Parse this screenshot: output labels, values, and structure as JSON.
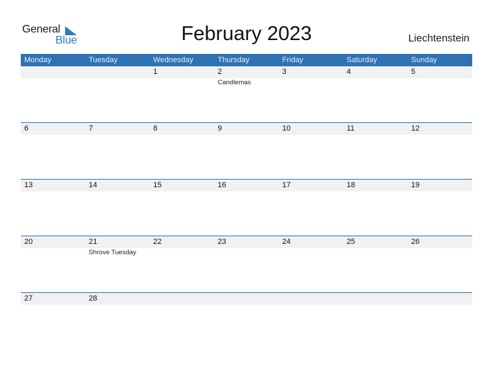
{
  "logo": {
    "general": "General",
    "blue": "Blue"
  },
  "title": "February 2023",
  "country": "Liechtenstein",
  "colors": {
    "accent": "#2e72b4",
    "date_strip": "#f1f1f1",
    "logo_blue": "#2e7bc4"
  },
  "weekdays": [
    "Monday",
    "Tuesday",
    "Wednesday",
    "Thursday",
    "Friday",
    "Saturday",
    "Sunday"
  ],
  "weeks": [
    {
      "days": [
        "",
        "",
        "1",
        "2",
        "3",
        "4",
        "5"
      ],
      "events": [
        "",
        "",
        "",
        "Candlemas",
        "",
        "",
        ""
      ]
    },
    {
      "days": [
        "6",
        "7",
        "8",
        "9",
        "10",
        "11",
        "12"
      ],
      "events": [
        "",
        "",
        "",
        "",
        "",
        "",
        ""
      ]
    },
    {
      "days": [
        "13",
        "14",
        "15",
        "16",
        "17",
        "18",
        "19"
      ],
      "events": [
        "",
        "",
        "",
        "",
        "",
        "",
        ""
      ]
    },
    {
      "days": [
        "20",
        "21",
        "22",
        "23",
        "24",
        "25",
        "26"
      ],
      "events": [
        "",
        "Shrove Tuesday",
        "",
        "",
        "",
        "",
        ""
      ]
    },
    {
      "days": [
        "27",
        "28",
        "",
        "",
        "",
        "",
        ""
      ],
      "events": [
        "",
        "",
        "",
        "",
        "",
        "",
        ""
      ]
    }
  ]
}
